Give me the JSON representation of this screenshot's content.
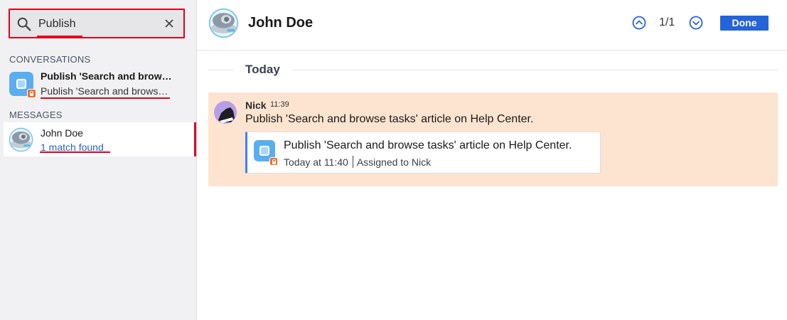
{
  "search": {
    "value": "Publish"
  },
  "sidebar": {
    "conversations_title": "CONVERSATIONS",
    "messages_title": "MESSAGES",
    "conversation": {
      "title": "Publish 'Search and browse tasks' article on Help Center.",
      "subtitle": "Publish 'Search and browse tasks' article on Help Center."
    },
    "message_result": {
      "name": "John Doe",
      "match": "1 match found"
    }
  },
  "header": {
    "contact_name": "John Doe",
    "counter": "1/1",
    "done_label": "Done"
  },
  "chat": {
    "day_label": "Today",
    "message": {
      "author": "Nick",
      "time": "11:39",
      "text": "Publish 'Search and browse tasks' article on Help Center.",
      "task": {
        "title": "Publish 'Search and browse tasks' article on Help Center.",
        "when": "Today at 11:40",
        "assigned_label": "Assigned to",
        "assignee": "Nick"
      }
    }
  },
  "colors": {
    "highlight": "#e3001b",
    "accent": "#2563d9",
    "message_bg": "#fde4d0",
    "task_icon": "#5aaef0",
    "lock_badge": "#f26b2a"
  },
  "icons": {
    "search": "search-icon",
    "clear": "close-icon",
    "prev": "chevron-up-icon",
    "next": "chevron-down-icon",
    "lock": "lock-icon"
  }
}
